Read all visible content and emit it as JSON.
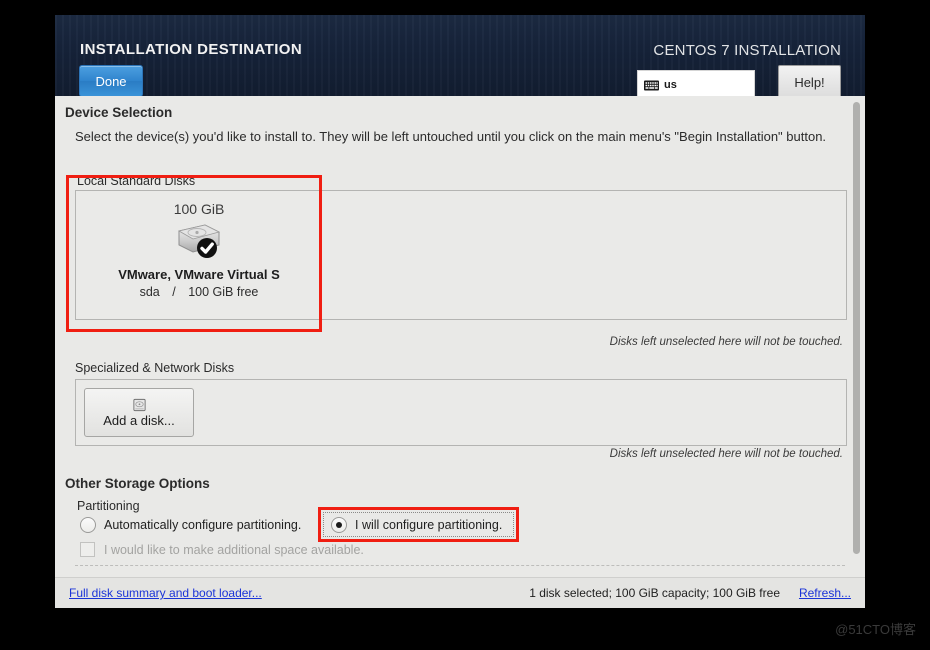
{
  "header": {
    "title": "INSTALLATION DESTINATION",
    "product_title": "CENTOS 7 INSTALLATION",
    "done_label": "Done",
    "help_label": "Help!",
    "keyboard_layout": "us",
    "keyboard_icon": "keyboard-icon",
    "accent_blue": "#2f84cd",
    "header_bg": "#16233a"
  },
  "device_selection": {
    "heading": "Device Selection",
    "description": "Select the device(s) you'd like to install to.  They will be left untouched until you click on the main menu's \"Begin Installation\" button.",
    "local_disks_label": "Local Standard Disks",
    "local_note": "Disks left unselected here will not be touched.",
    "disks": [
      {
        "capacity": "100 GiB",
        "name": "VMware, VMware Virtual S",
        "device": "sda",
        "separator": "/",
        "free": "100 GiB free",
        "icon": "hard-disk-icon",
        "selected": true
      }
    ],
    "specialized_label": "Specialized & Network Disks",
    "add_disk_label": "Add a disk...",
    "add_disk_icon": "add-disk-icon",
    "specialized_note": "Disks left unselected here will not be touched."
  },
  "other_storage": {
    "heading": "Other Storage Options",
    "partitioning_label": "Partitioning",
    "options": [
      {
        "label": "Automatically configure partitioning.",
        "selected": false
      },
      {
        "label": "I will configure partitioning.",
        "selected": true
      }
    ],
    "checkbox": {
      "label": "I would like to make additional space available.",
      "checked": false,
      "disabled": true
    }
  },
  "bottom_bar": {
    "summary_link": "Full disk summary and boot loader...",
    "status": "1 disk selected; 100 GiB capacity; 100 GiB free",
    "refresh_link": "Refresh..."
  },
  "annotations": {
    "highlight_color": "#f01e12",
    "boxes": [
      "local-standard-disks-highlight",
      "configure-partitioning-highlight"
    ]
  },
  "watermark": "@51CTO博客"
}
